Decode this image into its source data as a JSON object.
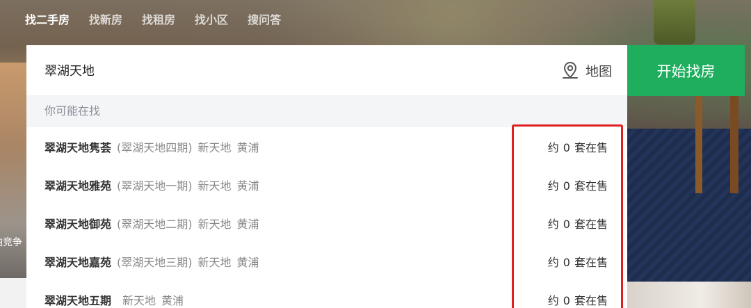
{
  "tabs": [
    {
      "label": "找二手房",
      "active": true
    },
    {
      "label": "找新房",
      "active": false
    },
    {
      "label": "找租房",
      "active": false
    },
    {
      "label": "找小区",
      "active": false
    },
    {
      "label": "搜问答",
      "active": false
    }
  ],
  "search": {
    "value": "翠湖天地",
    "map_icon": "map-pin-icon",
    "map_label": "地图",
    "button_label": "开始找房"
  },
  "dropdown": {
    "header": "你可能在找",
    "items": [
      {
        "name": "翠湖天地隽荟",
        "alias": "(翠湖天地四期)",
        "area": "新天地",
        "district": "黄浦",
        "prefix": "约",
        "count": "0",
        "suffix": "套在售"
      },
      {
        "name": "翠湖天地雅苑",
        "alias": "(翠湖天地一期)",
        "area": "新天地",
        "district": "黄浦",
        "prefix": "约",
        "count": "0",
        "suffix": "套在售"
      },
      {
        "name": "翠湖天地御苑",
        "alias": "(翠湖天地二期)",
        "area": "新天地",
        "district": "黄浦",
        "prefix": "约",
        "count": "0",
        "suffix": "套在售"
      },
      {
        "name": "翠湖天地嘉苑",
        "alias": "(翠湖天地三期)",
        "area": "新天地",
        "district": "黄浦",
        "prefix": "约",
        "count": "0",
        "suffix": "套在售"
      },
      {
        "name": "翠湖天地五期",
        "alias": "",
        "area": "新天地",
        "district": "黄浦",
        "prefix": "约",
        "count": "0",
        "suffix": "套在售"
      }
    ]
  },
  "background": {
    "edge_text": "拍竞争"
  },
  "colors": {
    "accent_green": "#1fae5e",
    "highlight_red": "#e02020"
  }
}
